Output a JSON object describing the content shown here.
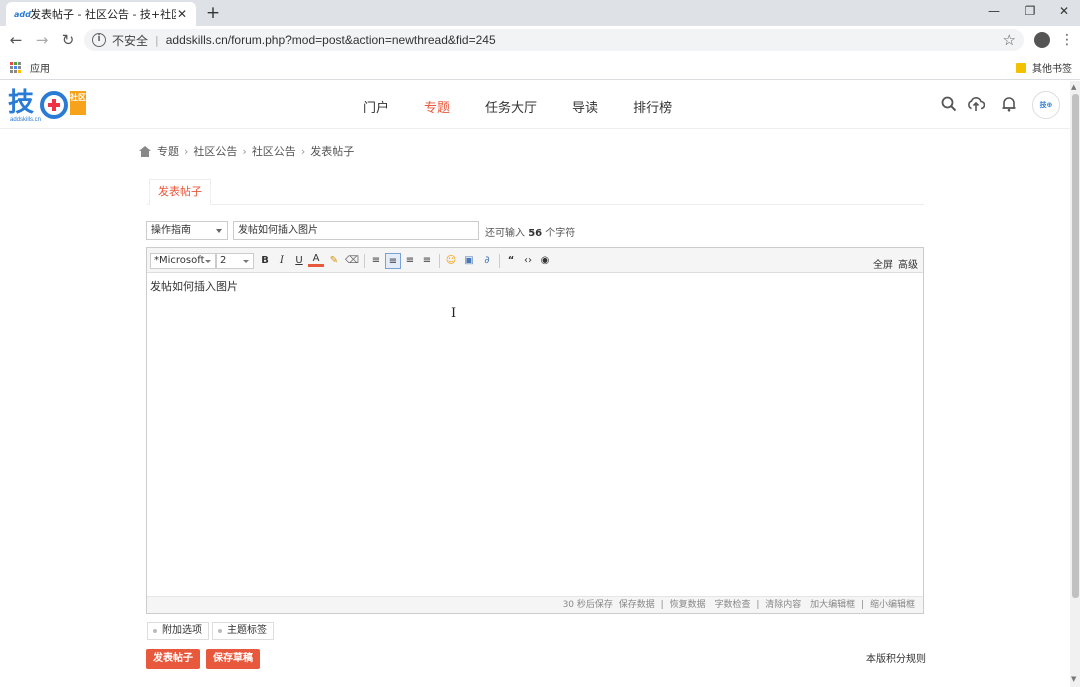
{
  "browser": {
    "tab_title": "发表帖子 - 社区公告 - 技+社区 -",
    "favicon_text": "add",
    "insecure_label": "不安全",
    "url": "addskills.cn/forum.php?mod=post&action=newthread&fid=245",
    "bookmarks": {
      "apps_label": "应用",
      "other_label": "其他书签"
    }
  },
  "site": {
    "logo_char": "技",
    "logo_badge": "社区",
    "logo_sub": "addskills.cn",
    "nav": [
      {
        "label": "门户",
        "active": false
      },
      {
        "label": "专题",
        "active": true
      },
      {
        "label": "任务大厅",
        "active": false
      },
      {
        "label": "导读",
        "active": false
      },
      {
        "label": "排行榜",
        "active": false
      }
    ],
    "avatar_text": "技⊕",
    "accent_color": "#e8583c",
    "brand_color": "#2a7bd5"
  },
  "breadcrumb": [
    "专题",
    "社区公告",
    "社区公告",
    "发表帖子"
  ],
  "post_tab": "发表帖子",
  "form": {
    "type_value": "操作指南",
    "subject_value": "发帖如何插入图片",
    "remain_prefix": "还可输入",
    "remain_count": "56",
    "remain_suffix": "个字符"
  },
  "editor": {
    "font_value": "*Microsoft",
    "size_value": "2",
    "tools": [
      "bold",
      "italic",
      "underline",
      "font-color",
      "background-color",
      "clear-format",
      "align-left",
      "align-center",
      "align-justify",
      "align-right",
      "emoticon",
      "image",
      "attachment",
      "quote",
      "code",
      "qq"
    ],
    "fullscreen": "全屏",
    "advanced": "高级",
    "body_text": "发帖如何插入图片",
    "status": [
      "30 秒后保存",
      "保存数据",
      "|",
      "恢复数据",
      "字数检查",
      "|",
      "清除内容",
      "加大编辑框",
      "|",
      "缩小编辑框"
    ]
  },
  "options": {
    "extra": "附加选项",
    "tags": "主题标签"
  },
  "actions": {
    "post": "发表帖子",
    "draft": "保存草稿",
    "rules": "本版积分规则"
  }
}
